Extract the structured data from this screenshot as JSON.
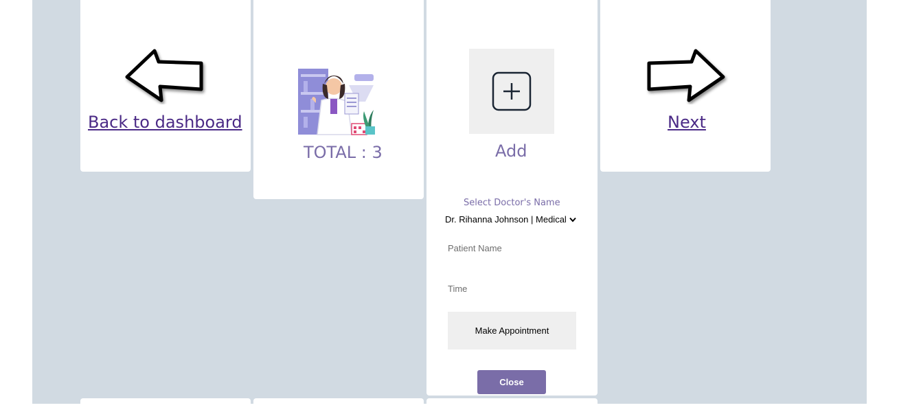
{
  "nav": {
    "back_label": "Back to dashboard",
    "next_label": "Next"
  },
  "stats": {
    "total_label": "TOTAL : 3"
  },
  "add_panel": {
    "add_label": "Add",
    "select_label": "Select Doctor's Name",
    "selected_doctor": "Dr. Rihanna Johnson | Medical",
    "patient_placeholder": "Patient Name",
    "time_placeholder": "Time",
    "appointment_button": "Make Appointment",
    "close_button": "Close"
  },
  "colors": {
    "accent": "#7a6da8",
    "link": "#4b2a86",
    "background": "#d1dae2"
  }
}
